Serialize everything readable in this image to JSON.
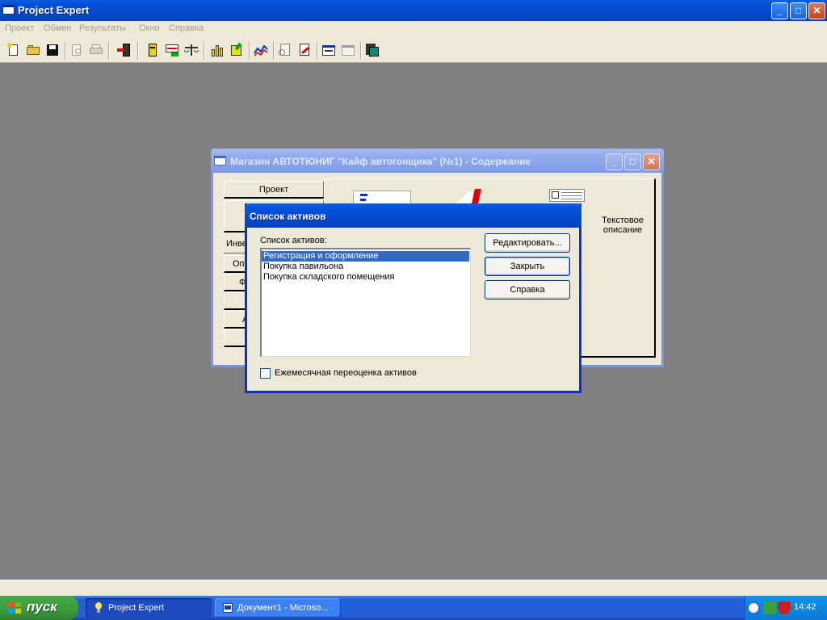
{
  "app": {
    "title": "Project Expert",
    "controls": {
      "minimize": "_",
      "maximize": "□",
      "close": "✕"
    }
  },
  "menu": [
    "Проект",
    "Обмен",
    "Результаты",
    "Окно",
    "Справка"
  ],
  "toolbar": {
    "icons": [
      "new-file-icon",
      "open-folder-icon",
      "save-icon",
      "print-preview-icon",
      "print-icon",
      "exit-icon",
      "document-icon",
      "cashflow-icon",
      "balance-scale-icon",
      "chart-bars-icon",
      "edit-icon",
      "line-chart-icon",
      "report-icon",
      "report-edit-icon",
      "window-icon",
      "window-list-icon",
      "calculator-icon"
    ]
  },
  "content_window": {
    "title": "Магазин АВТОТЮНИГ \"Кайф автогонщика\" (№1) - Содержание",
    "controls": {
      "minimize": "_",
      "maximize": "□",
      "close": "✕"
    },
    "side_buttons": [
      "Проект",
      "",
      "Инве",
      "Опе",
      "Ф",
      "",
      "А",
      "А"
    ],
    "text_description": "Текстовое описание"
  },
  "dialog": {
    "title": "Список активов",
    "list_label": "Список активов:",
    "list_items": [
      "Регистрация и оформление",
      "Покупка павильона",
      "Покупка складского помещения"
    ],
    "selected_index": 0,
    "buttons": {
      "edit": "Редактировать...",
      "close": "Закрыть",
      "help": "Справка"
    },
    "checkbox_label": "Ежемесячная переоценка активов",
    "checkbox_checked": false
  },
  "taskbar": {
    "start_label": "пуск",
    "tasks": [
      {
        "label": "Project Expert",
        "active": true
      },
      {
        "label": "Документ1 - Microso...",
        "active": false
      }
    ],
    "time": "14:42"
  },
  "colors": {
    "accent": "#0550d8",
    "selection": "#316ac5",
    "desktop": "#808080",
    "window_face": "#ece9d8"
  }
}
